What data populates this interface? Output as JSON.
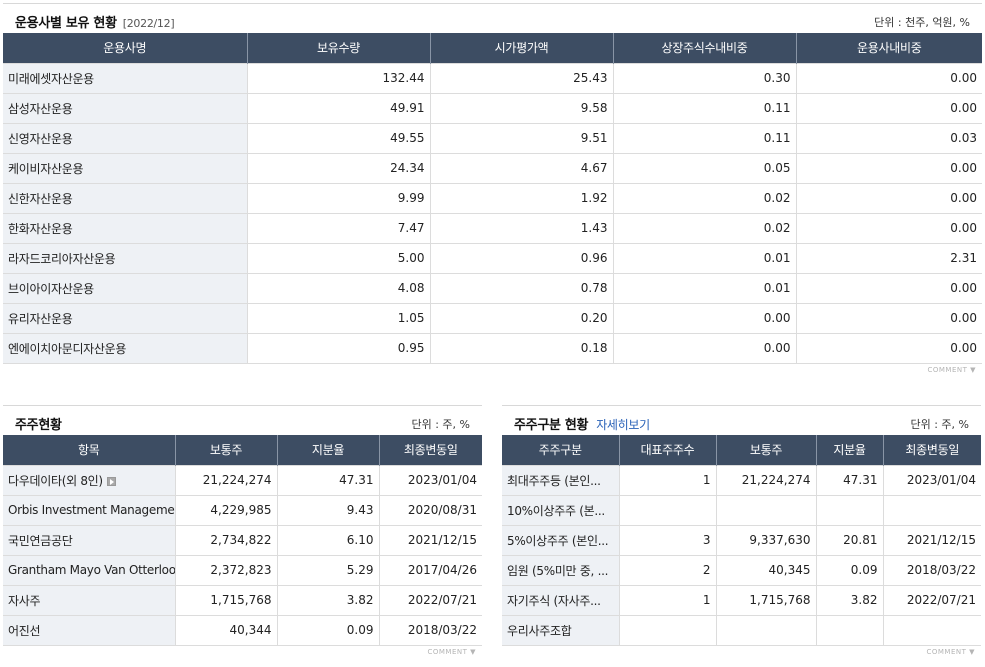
{
  "managers": {
    "title": "운용사별 보유 현황",
    "date": "[2022/12]",
    "unit": "단위 : 천주, 억원, %",
    "headers": [
      "운용사명",
      "보유수량",
      "시가평가액",
      "상장주식수내비중",
      "운용사내비중"
    ],
    "rows": [
      [
        "미래에셋자산운용",
        "132.44",
        "25.43",
        "0.30",
        "0.00"
      ],
      [
        "삼성자산운용",
        "49.91",
        "9.58",
        "0.11",
        "0.00"
      ],
      [
        "신영자산운용",
        "49.55",
        "9.51",
        "0.11",
        "0.03"
      ],
      [
        "케이비자산운용",
        "24.34",
        "4.67",
        "0.05",
        "0.00"
      ],
      [
        "신한자산운용",
        "9.99",
        "1.92",
        "0.02",
        "0.00"
      ],
      [
        "한화자산운용",
        "7.47",
        "1.43",
        "0.02",
        "0.00"
      ],
      [
        "라자드코리아자산운용",
        "5.00",
        "0.96",
        "0.01",
        "2.31"
      ],
      [
        "브이아이자산운용",
        "4.08",
        "0.78",
        "0.01",
        "0.00"
      ],
      [
        "유리자산운용",
        "1.05",
        "0.20",
        "0.00",
        "0.00"
      ],
      [
        "엔에이치아문디자산운용",
        "0.95",
        "0.18",
        "0.00",
        "0.00"
      ]
    ],
    "comment": "COMMENT ▼"
  },
  "holders": {
    "title": "주주현황",
    "unit": "단위 : 주, %",
    "headers": [
      "항목",
      "보통주",
      "지분율",
      "최종변동일"
    ],
    "rows": [
      [
        "다우데이타(외 8인)",
        "21,224,274",
        "47.31",
        "2023/01/04"
      ],
      [
        "Orbis Investment Management",
        "4,229,985",
        "9.43",
        "2020/08/31"
      ],
      [
        "국민연금공단",
        "2,734,822",
        "6.10",
        "2021/12/15"
      ],
      [
        "Grantham Mayo Van Otterloo &",
        "2,372,823",
        "5.29",
        "2017/04/26"
      ],
      [
        "자사주",
        "1,715,768",
        "3.82",
        "2022/07/21"
      ],
      [
        "어진선",
        "40,344",
        "0.09",
        "2018/03/22"
      ]
    ],
    "icon": "play-icon",
    "comment": "COMMENT ▼"
  },
  "classes": {
    "title": "주주구분 현황",
    "link": "자세히보기",
    "unit": "단위 : 주, %",
    "headers": [
      "주주구분",
      "대표주주수",
      "보통주",
      "지분율",
      "최종변동일"
    ],
    "rows": [
      [
        "최대주주등 (본인...",
        "1",
        "21,224,274",
        "47.31",
        "2023/01/04"
      ],
      [
        "10%이상주주 (본...",
        "",
        "",
        "",
        ""
      ],
      [
        "5%이상주주 (본인...",
        "3",
        "9,337,630",
        "20.81",
        "2021/12/15"
      ],
      [
        "임원 (5%미만 중, ...",
        "2",
        "40,345",
        "0.09",
        "2018/03/22"
      ],
      [
        "자기주식 (자사주...",
        "1",
        "1,715,768",
        "3.82",
        "2022/07/21"
      ],
      [
        "우리사주조합",
        "",
        "",
        "",
        ""
      ]
    ],
    "comment": "COMMENT ▼"
  }
}
